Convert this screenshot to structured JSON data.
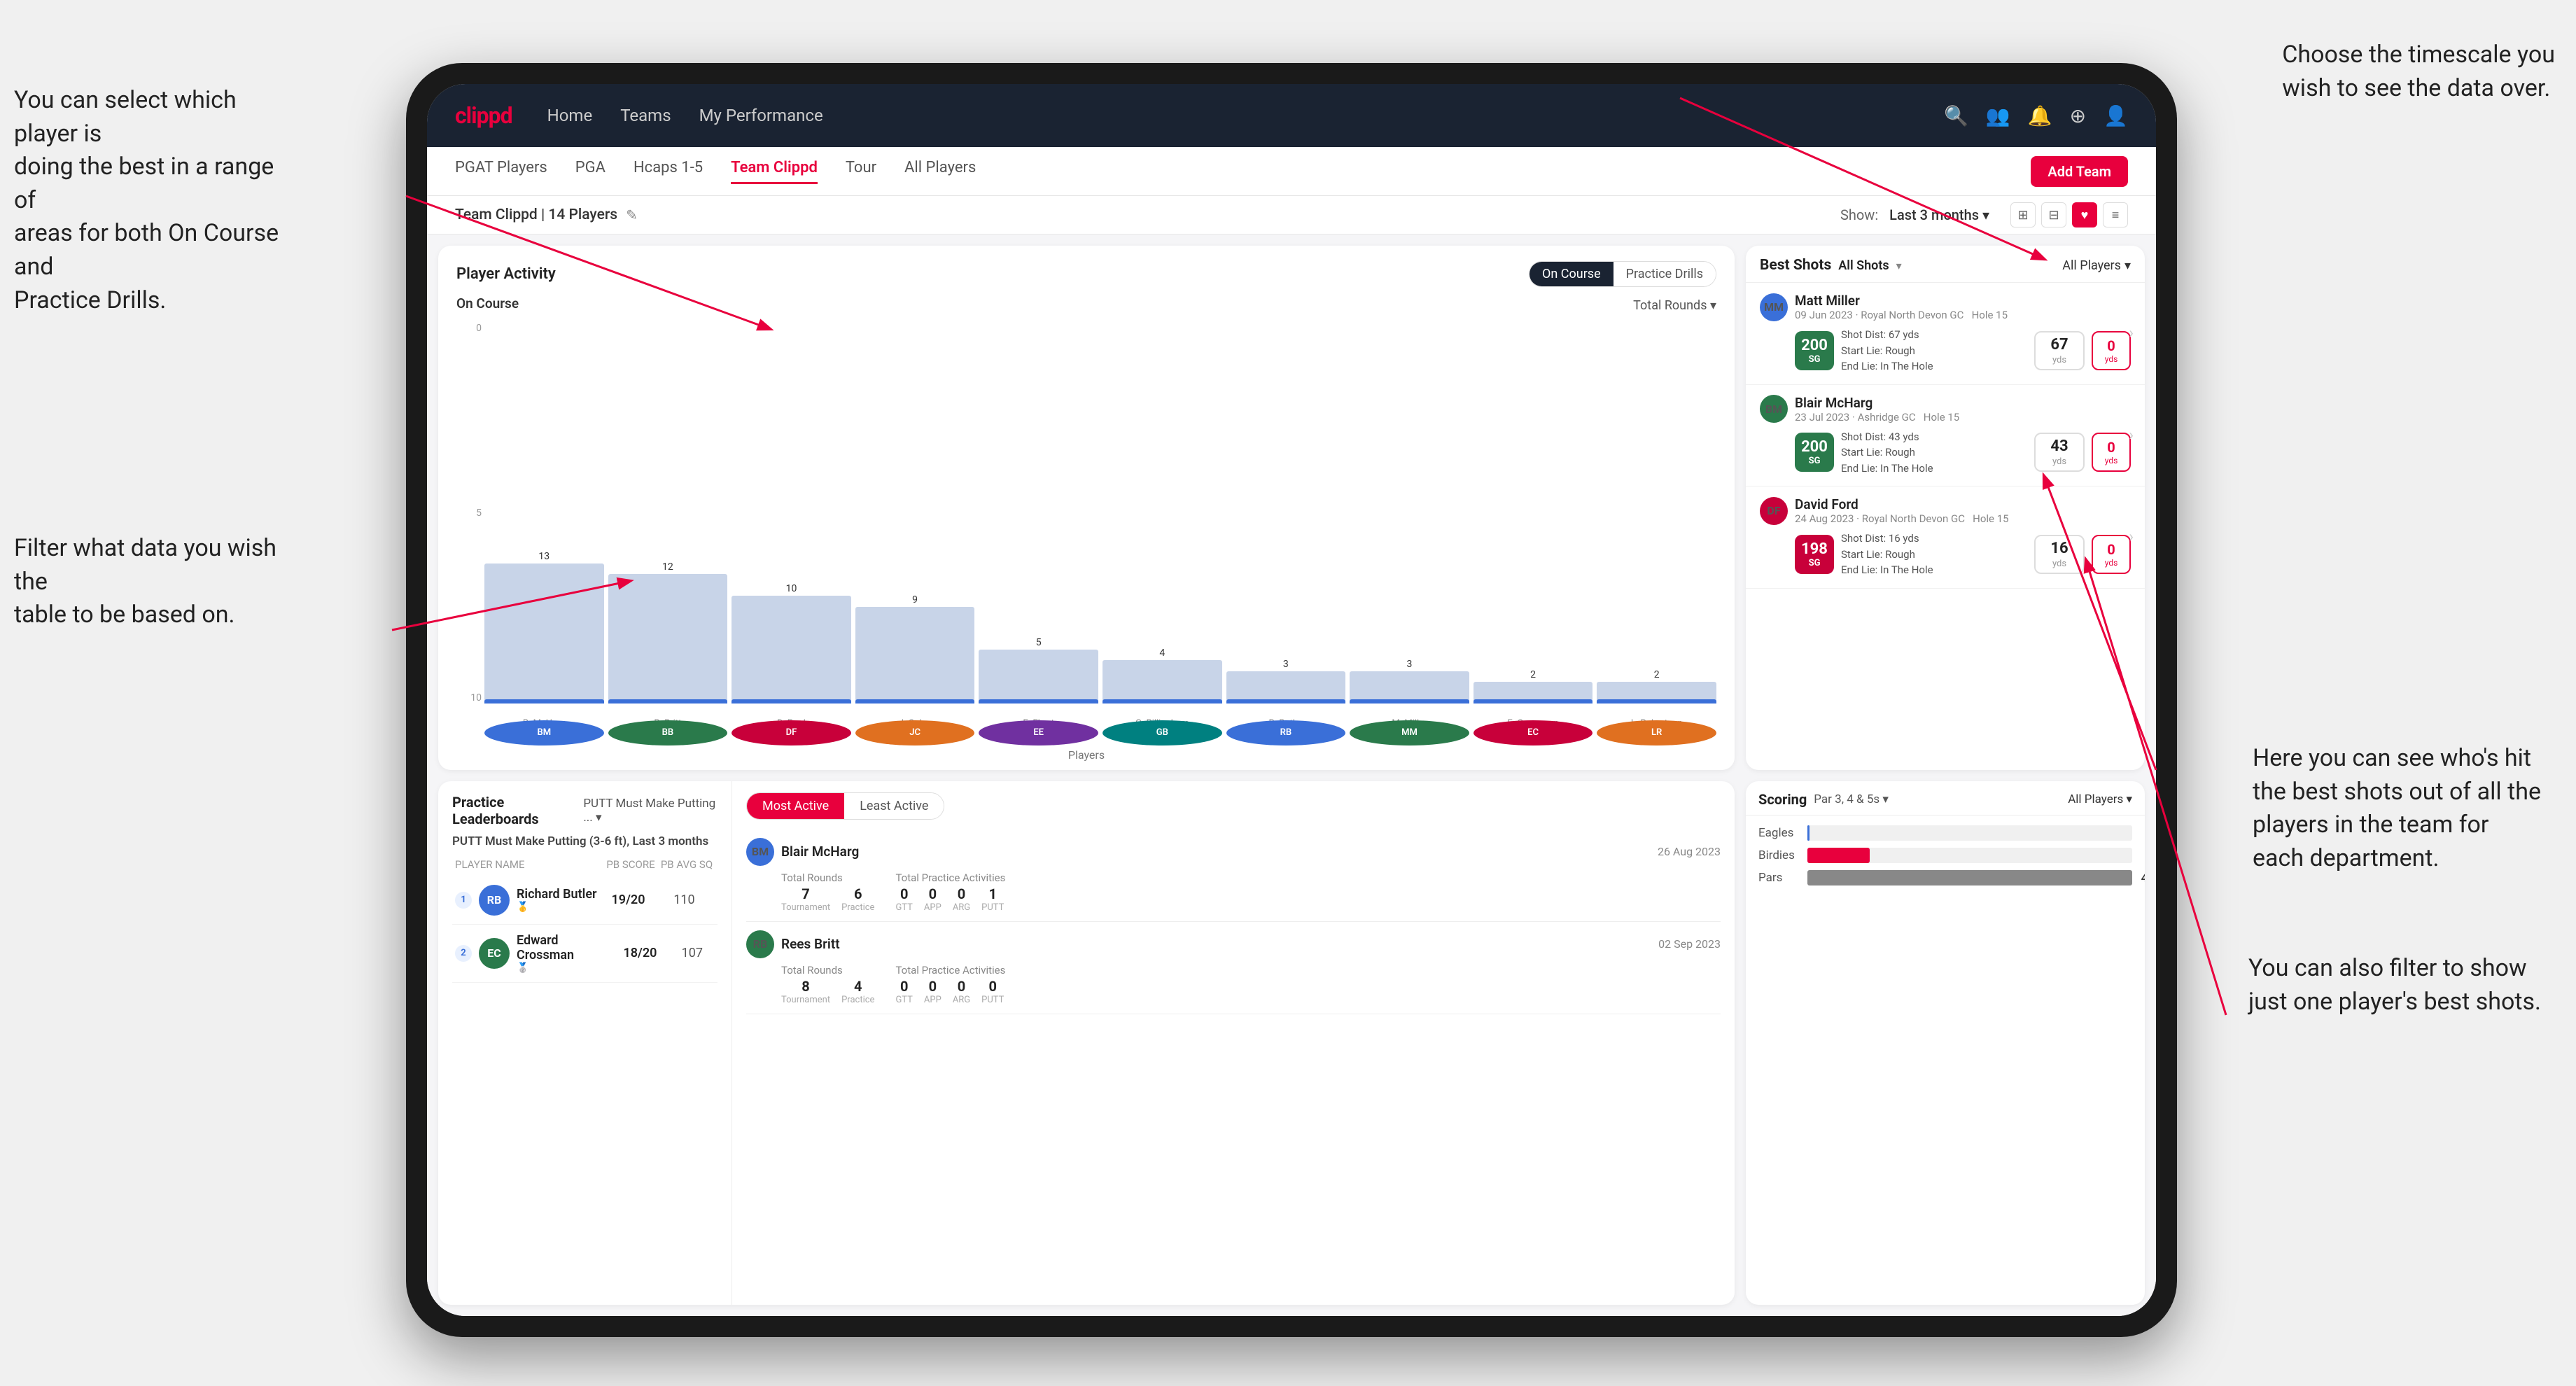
{
  "annotations": {
    "top_right": "Choose the timescale you\nwish to see the data over.",
    "top_left": "You can select which player is\ndoing the best in a range of\nareas for both On Course and\nPractice Drills.",
    "mid_left": "Filter what data you wish the\ntable to be based on.",
    "bottom_right": "Here you can see who's hit\nthe best shots out of all the\nplayers in the team for\neach department.",
    "bottom_right2": "You can also filter to show\njust one player's best shots."
  },
  "nav": {
    "logo": "clippd",
    "links": [
      "Home",
      "Teams",
      "My Performance"
    ],
    "icons": [
      "🔍",
      "👤",
      "🔔",
      "☀",
      "👤"
    ]
  },
  "sub_nav": {
    "items": [
      "PGAT Players",
      "PGA",
      "Hcaps 1-5",
      "Team Clippd",
      "Tour",
      "All Players"
    ],
    "active": "Team Clippd",
    "add_btn": "Add Team"
  },
  "team_header": {
    "title": "Team Clippd | 14 Players",
    "show_label": "Show:",
    "show_value": "Last 3 months",
    "view_icons": [
      "⊞",
      "⊟",
      "♥",
      "≡"
    ]
  },
  "player_activity": {
    "title": "Player Activity",
    "toggle": [
      "On Course",
      "Practice Drills"
    ],
    "active_toggle": "On Course",
    "section": "On Course",
    "dropdown": "Total Rounds",
    "y_labels": [
      "0",
      "5",
      "10"
    ],
    "bars": [
      {
        "name": "B. McHarg",
        "value": 13,
        "pct": 100,
        "initials": "BM",
        "color": "av-blue"
      },
      {
        "name": "B. Britt",
        "value": 12,
        "pct": 92,
        "initials": "BB",
        "color": "av-green"
      },
      {
        "name": "D. Ford",
        "value": 10,
        "pct": 77,
        "initials": "DF",
        "color": "av-red"
      },
      {
        "name": "J. Coles",
        "value": 9,
        "pct": 69,
        "initials": "JC",
        "color": "av-orange"
      },
      {
        "name": "E. Ebert",
        "value": 5,
        "pct": 38,
        "initials": "EE",
        "color": "av-purple"
      },
      {
        "name": "G. Billingham",
        "value": 4,
        "pct": 31,
        "initials": "GB",
        "color": "av-teal"
      },
      {
        "name": "R. Butler",
        "value": 3,
        "pct": 23,
        "initials": "RB",
        "color": "av-blue"
      },
      {
        "name": "M. Miller",
        "value": 3,
        "pct": 23,
        "initials": "MM",
        "color": "av-green"
      },
      {
        "name": "E. Crossman",
        "value": 2,
        "pct": 15,
        "initials": "EC",
        "color": "av-red"
      },
      {
        "name": "L. Robertson",
        "value": 2,
        "pct": 15,
        "initials": "LR",
        "color": "av-orange"
      }
    ],
    "x_axis_title": "Players"
  },
  "best_shots": {
    "title": "Best Shots",
    "tabs": [
      "All Shots",
      "All Players"
    ],
    "players": [
      {
        "name": "Matt Miller",
        "date": "09 Jun 2023 · Royal North Devon GC",
        "hole": "Hole 15",
        "badge_num": "200",
        "badge_label": "SG",
        "badge_color": "green",
        "shot_dist": "67 yds",
        "start_lie": "Rough",
        "end_lie": "In The Hole",
        "stat1": "67",
        "stat1_unit": "yds",
        "stat2": "0",
        "initials": "MM",
        "av_color": "av-blue"
      },
      {
        "name": "Blair McHarg",
        "date": "23 Jul 2023 · Ashridge GC",
        "hole": "Hole 15",
        "badge_num": "200",
        "badge_label": "SG",
        "badge_color": "green",
        "shot_dist": "43 yds",
        "start_lie": "Rough",
        "end_lie": "In The Hole",
        "stat1": "43",
        "stat1_unit": "yds",
        "stat2": "0",
        "initials": "BM",
        "av_color": "av-green"
      },
      {
        "name": "David Ford",
        "date": "24 Aug 2023 · Royal North Devon GC",
        "hole": "Hole 15",
        "badge_num": "198",
        "badge_label": "SG",
        "badge_color": "red",
        "shot_dist": "16 yds",
        "start_lie": "Rough",
        "end_lie": "In The Hole",
        "stat1": "16",
        "stat1_unit": "yds",
        "stat2": "0",
        "initials": "DF",
        "av_color": "av-red"
      }
    ]
  },
  "practice_lb": {
    "title": "Practice Leaderboards",
    "filter": "PUTT Must Make Putting ...",
    "subtitle": "PUTT Must Make Putting (3-6 ft), Last 3 months",
    "cols": [
      "PLAYER NAME",
      "PB SCORE",
      "PB AVG SQ"
    ],
    "rows": [
      {
        "rank": 1,
        "name": "Richard Butler",
        "score": "19/20",
        "avg": "110",
        "initials": "RB",
        "color": "av-blue"
      },
      {
        "rank": 2,
        "name": "Edward Crossman",
        "score": "18/20",
        "avg": "107",
        "initials": "EC",
        "color": "av-green"
      }
    ]
  },
  "most_active": {
    "tabs": [
      "Most Active",
      "Least Active"
    ],
    "players": [
      {
        "name": "Blair McHarg",
        "date": "26 Aug 2023",
        "total_rounds_label": "Total Rounds",
        "tournament": "7",
        "practice": "6",
        "total_practice_label": "Total Practice Activities",
        "gtt": "0",
        "app": "0",
        "arg": "0",
        "putt": "1",
        "initials": "BM",
        "av_color": "av-blue"
      },
      {
        "name": "Rees Britt",
        "date": "02 Sep 2023",
        "total_rounds_label": "Total Rounds",
        "tournament": "8",
        "practice": "4",
        "total_practice_label": "Total Practice Activities",
        "gtt": "0",
        "app": "0",
        "arg": "0",
        "putt": "0",
        "initials": "RB",
        "av_color": "av-green"
      }
    ]
  },
  "scoring": {
    "title": "Scoring",
    "filter": "Par 3, 4 & 5s",
    "player_filter": "All Players",
    "bars": [
      {
        "label": "Eagles",
        "value": 3,
        "max": 499,
        "color": "#3a6fd8"
      },
      {
        "label": "Birdies",
        "value": 96,
        "max": 499,
        "color": "#e8003d"
      },
      {
        "label": "Pars",
        "value": 499,
        "max": 499,
        "color": "#888"
      }
    ]
  }
}
